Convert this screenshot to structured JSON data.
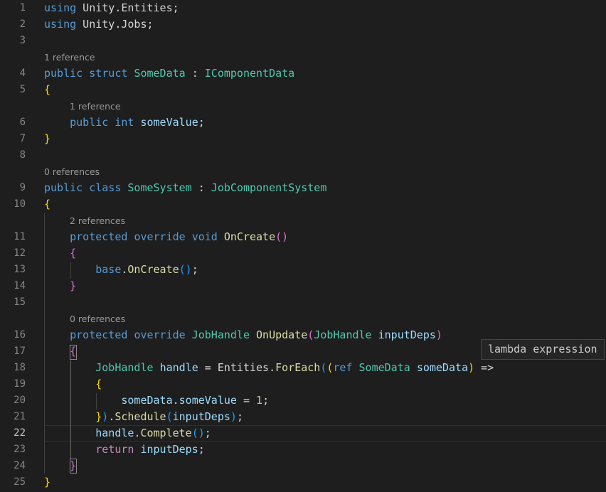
{
  "editor": {
    "active_line": "22",
    "lines": [
      {
        "n": "1",
        "tokens": [
          [
            "kw",
            "using"
          ],
          [
            "pu",
            " Unity.Entities;"
          ]
        ]
      },
      {
        "n": "2",
        "tokens": [
          [
            "kw",
            "using"
          ],
          [
            "pu",
            " Unity.Jobs;"
          ]
        ]
      },
      {
        "n": "3",
        "tokens": []
      },
      {
        "n": "4",
        "lens": "1 reference",
        "indent": 0,
        "tokens": [
          [
            "kw",
            "public"
          ],
          [
            "pu",
            " "
          ],
          [
            "kw",
            "struct"
          ],
          [
            "pu",
            " "
          ],
          [
            "ty",
            "SomeData"
          ],
          [
            "pu",
            " : "
          ],
          [
            "ty",
            "IComponentData"
          ]
        ]
      },
      {
        "n": "5",
        "tokens": [
          [
            "b1",
            "{"
          ]
        ]
      },
      {
        "n": "6",
        "lens": "1 reference",
        "indent": 1,
        "tokens": [
          [
            "pu",
            "    "
          ],
          [
            "kw",
            "public"
          ],
          [
            "pu",
            " "
          ],
          [
            "kw",
            "int"
          ],
          [
            "pu",
            " "
          ],
          [
            "va",
            "someValue"
          ],
          [
            "pu",
            ";"
          ]
        ]
      },
      {
        "n": "7",
        "tokens": [
          [
            "b1",
            "}"
          ]
        ]
      },
      {
        "n": "8",
        "tokens": []
      },
      {
        "n": "9",
        "lens": "0 references",
        "indent": 0,
        "tokens": [
          [
            "kw",
            "public"
          ],
          [
            "pu",
            " "
          ],
          [
            "kw",
            "class"
          ],
          [
            "pu",
            " "
          ],
          [
            "ty",
            "SomeSystem"
          ],
          [
            "pu",
            " : "
          ],
          [
            "ty",
            "JobComponentSystem"
          ]
        ]
      },
      {
        "n": "10",
        "tokens": [
          [
            "b1",
            "{"
          ]
        ]
      },
      {
        "n": "11",
        "lens": "2 references",
        "indent": 1,
        "tokens": [
          [
            "pu",
            "    "
          ],
          [
            "kw",
            "protected"
          ],
          [
            "pu",
            " "
          ],
          [
            "kw",
            "override"
          ],
          [
            "pu",
            " "
          ],
          [
            "kw",
            "void"
          ],
          [
            "pu",
            " "
          ],
          [
            "fn",
            "OnCreate"
          ],
          [
            "b2",
            "()"
          ]
        ]
      },
      {
        "n": "12",
        "tokens": [
          [
            "pu",
            "    "
          ],
          [
            "b2",
            "{"
          ]
        ]
      },
      {
        "n": "13",
        "tokens": [
          [
            "pu",
            "        "
          ],
          [
            "kw",
            "base"
          ],
          [
            "pu",
            "."
          ],
          [
            "fn",
            "OnCreate"
          ],
          [
            "b3",
            "()"
          ],
          [
            "pu",
            ";"
          ]
        ]
      },
      {
        "n": "14",
        "tokens": [
          [
            "pu",
            "    "
          ],
          [
            "b2",
            "}"
          ]
        ]
      },
      {
        "n": "15",
        "tokens": []
      },
      {
        "n": "16",
        "lens": "0 references",
        "indent": 1,
        "tokens": [
          [
            "pu",
            "    "
          ],
          [
            "kw",
            "protected"
          ],
          [
            "pu",
            " "
          ],
          [
            "kw",
            "override"
          ],
          [
            "pu",
            " "
          ],
          [
            "ty",
            "JobHandle"
          ],
          [
            "pu",
            " "
          ],
          [
            "fn",
            "OnUpdate"
          ],
          [
            "b2",
            "("
          ],
          [
            "ty",
            "JobHandle"
          ],
          [
            "pu",
            " "
          ],
          [
            "va",
            "inputDeps"
          ],
          [
            "b2",
            ")"
          ]
        ]
      },
      {
        "n": "17",
        "tokens": [
          [
            "pu",
            "    "
          ],
          [
            "b2",
            "{"
          ]
        ]
      },
      {
        "n": "18",
        "tokens": [
          [
            "pu",
            "        "
          ],
          [
            "ty",
            "JobHandle"
          ],
          [
            "pu",
            " "
          ],
          [
            "va",
            "handle"
          ],
          [
            "pu",
            " = Entities."
          ],
          [
            "fn",
            "ForEach"
          ],
          [
            "b3",
            "("
          ],
          [
            "b1",
            "("
          ],
          [
            "kw",
            "ref"
          ],
          [
            "pu",
            " "
          ],
          [
            "ty",
            "SomeData"
          ],
          [
            "pu",
            " "
          ],
          [
            "va",
            "someData"
          ],
          [
            "b1",
            ")"
          ],
          [
            "pu",
            " =>"
          ]
        ]
      },
      {
        "n": "19",
        "tokens": [
          [
            "pu",
            "        "
          ],
          [
            "b1",
            "{"
          ]
        ]
      },
      {
        "n": "20",
        "tokens": [
          [
            "pu",
            "            "
          ],
          [
            "va",
            "someData"
          ],
          [
            "pu",
            "."
          ],
          [
            "va",
            "someValue"
          ],
          [
            "pu",
            " = "
          ],
          [
            "nu",
            "1"
          ],
          [
            "pu",
            ";"
          ]
        ]
      },
      {
        "n": "21",
        "tokens": [
          [
            "pu",
            "        "
          ],
          [
            "b1",
            "}"
          ],
          [
            "b3",
            ")"
          ],
          [
            "pu",
            "."
          ],
          [
            "fn",
            "Schedule"
          ],
          [
            "b3",
            "("
          ],
          [
            "va",
            "inputDeps"
          ],
          [
            "b3",
            ")"
          ],
          [
            "pu",
            ";"
          ]
        ]
      },
      {
        "n": "22",
        "tokens": [
          [
            "pu",
            "        "
          ],
          [
            "va",
            "handle"
          ],
          [
            "pu",
            "."
          ],
          [
            "fn",
            "Complete"
          ],
          [
            "b3",
            "()"
          ],
          [
            "pu",
            ";"
          ]
        ]
      },
      {
        "n": "23",
        "tokens": [
          [
            "pu",
            "        "
          ],
          [
            "ctl",
            "return"
          ],
          [
            "pu",
            " "
          ],
          [
            "va",
            "inputDeps"
          ],
          [
            "pu",
            ";"
          ]
        ]
      },
      {
        "n": "24",
        "tokens": [
          [
            "pu",
            "    "
          ],
          [
            "b2",
            "}"
          ]
        ]
      },
      {
        "n": "25",
        "tokens": [
          [
            "b1",
            "}"
          ]
        ]
      }
    ]
  },
  "hover": {
    "tooltip": "lambda expression"
  }
}
